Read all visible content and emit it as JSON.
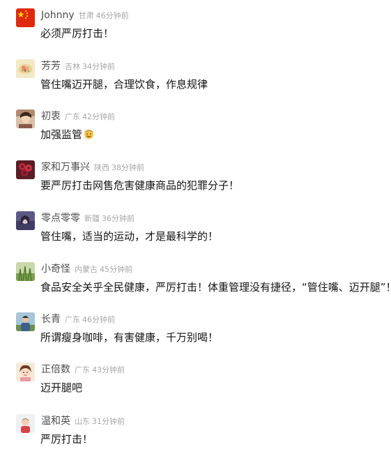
{
  "comments": [
    {
      "username": "Johnny",
      "location": "甘肃",
      "time": "46分钟前",
      "text": "必须严厉打击！",
      "avatar": "china-flag-icon"
    },
    {
      "username": "芳芳",
      "location": "吉林",
      "time": "34分钟前",
      "text": "管住嘴迈开腿，合理饮食，作息规律",
      "avatar": "flower-avatar"
    },
    {
      "username": "初衷",
      "location": "广东",
      "time": "42分钟前",
      "text": "加强监管",
      "emoji": "smiling-face-icon",
      "avatar": "portrait-avatar"
    },
    {
      "username": "家和万事兴",
      "location": "陕西",
      "time": "38分钟前",
      "text": "要严厉打击网售危害健康商品的犯罪分子！",
      "avatar": "roses-avatar"
    },
    {
      "username": "零点零零",
      "location": "新疆",
      "time": "36分钟前",
      "text": "管住嘴，适当的运动，才是最科学的！",
      "avatar": "purple-portrait-avatar"
    },
    {
      "username": "小奇怪",
      "location": "内蒙古",
      "time": "45分钟前",
      "text": "食品安全关乎全民健康，严厉打击！体重管理没有捷径，“管住嘴、迈开腿”！",
      "avatar": "grass-avatar"
    },
    {
      "username": "长青",
      "location": "广东",
      "time": "46分钟前",
      "text": "所谓瘦身咖啡，有害健康，千万别喝！",
      "avatar": "person-outdoor-avatar"
    },
    {
      "username": "正倍数",
      "location": "广东",
      "time": "43分钟前",
      "text": "迈开腿吧",
      "avatar": "cartoon-girl-avatar"
    },
    {
      "username": "温和英",
      "location": "山东",
      "time": "31分钟前",
      "text": "严厉打击！",
      "avatar": "child-avatar"
    }
  ],
  "colors": {
    "username": "#4d4d4d",
    "meta": "#a6a6a6",
    "text": "#141414",
    "flag_red": "#de2910",
    "flag_star": "#ffde00"
  }
}
